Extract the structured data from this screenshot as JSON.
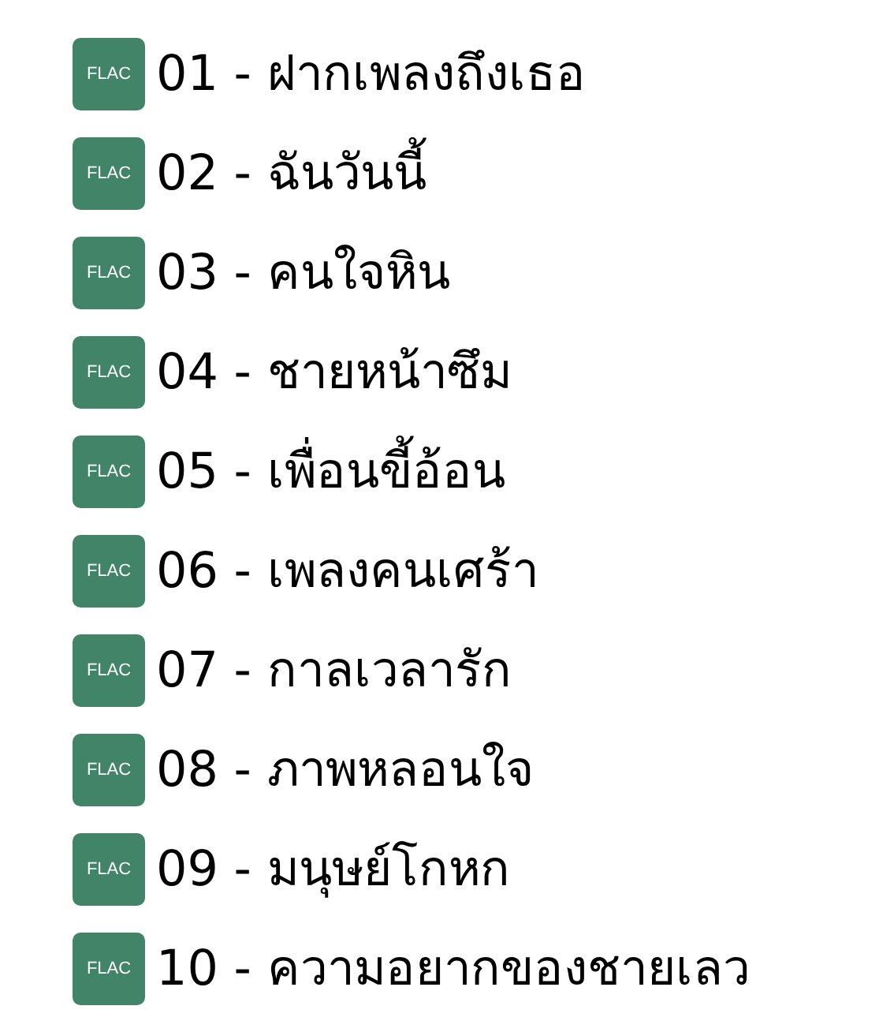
{
  "tracks": [
    {
      "format": "FLAC",
      "title": "01 - ฝากเพลงถึงเธอ"
    },
    {
      "format": "FLAC",
      "title": "02 - ฉันวันนี้"
    },
    {
      "format": "FLAC",
      "title": "03 - คนใจหิน"
    },
    {
      "format": "FLAC",
      "title": "04 - ชายหน้าซึม"
    },
    {
      "format": "FLAC",
      "title": "05 - เพื่อนขี้อ้อน"
    },
    {
      "format": "FLAC",
      "title": "06 - เพลงคนเศร้า"
    },
    {
      "format": "FLAC",
      "title": "07 - กาลเวลารัก"
    },
    {
      "format": "FLAC",
      "title": "08 - ภาพหลอนใจ"
    },
    {
      "format": "FLAC",
      "title": "09 - มนุษย์โกหก"
    },
    {
      "format": "FLAC",
      "title": "10 - ความอยากของชายเลว"
    }
  ]
}
